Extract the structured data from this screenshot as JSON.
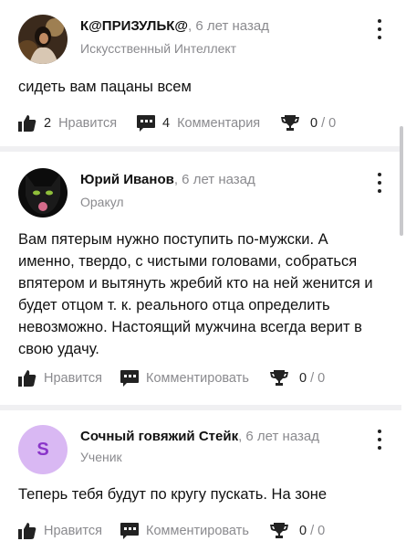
{
  "answers": [
    {
      "author": "К@ПРИЗУЛЬК@",
      "time": ", 6 лет назад",
      "role": "Искусственный Интеллект",
      "text": "сидеть вам пацаны всем",
      "likes_count": "2",
      "likes_label": "Нравится",
      "comments_count": "4",
      "comments_label": "Комментария",
      "score_a": "0",
      "score_sep": " / ",
      "score_b": "0"
    },
    {
      "author": "Юрий Иванов",
      "time": ", 6 лет назад",
      "role": "Оракул",
      "text": "Вам пятерым нужно поступить по-мужски. А именно, твердо, с чистыми головами, собраться впятером и вытянуть жребий кто на ней женится и будет отцом т. к. реального отца определить невозможно. Настоящий мужчина всегда верит в свою удачу.",
      "likes_label": "Нравится",
      "comments_label": "Комментировать",
      "score_a": "0",
      "score_sep": " / ",
      "score_b": "0"
    },
    {
      "author": "Сочный говяжий Стейк",
      "time": ", 6 лет назад",
      "role": "Ученик",
      "avatar_letter": "S",
      "text": "Теперь тебя будут по кругу пускать. На зоне",
      "likes_label": "Нравится",
      "comments_label": "Комментировать",
      "score_a": "0",
      "score_sep": " / ",
      "score_b": "0"
    }
  ],
  "icons": [
    "thumbs-up-icon",
    "comment-icon",
    "trophy-icon",
    "more-vertical-icon"
  ],
  "colors": {
    "accent_letter_avatar_bg": "#d9b8f3",
    "accent_letter_avatar_fg": "#8a35c9",
    "muted_text": "#8a8a8e",
    "separator": "#f0f0f2"
  }
}
